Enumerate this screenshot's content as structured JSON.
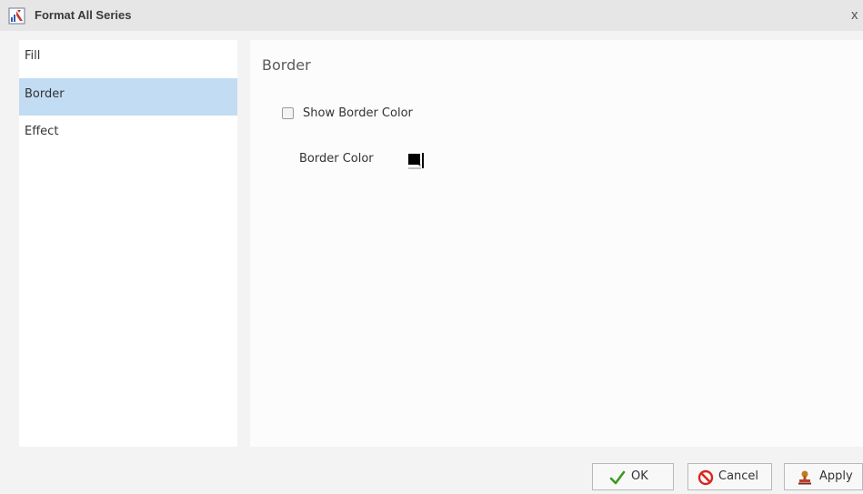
{
  "dialog": {
    "title": "Format All Series",
    "close_symbol": "x"
  },
  "nav": {
    "items": [
      {
        "label": "Fill",
        "selected": false
      },
      {
        "label": "Border",
        "selected": true
      },
      {
        "label": "Effect",
        "selected": false
      }
    ]
  },
  "border": {
    "section_title": "Border",
    "show_border_color_label": "Show Border Color",
    "show_border_color_checked": false,
    "border_color_label": "Border Color",
    "border_color_value": "#000000"
  },
  "footer": {
    "ok_label": "OK",
    "cancel_label": "Cancel",
    "apply_label": "Apply"
  },
  "icons": {
    "title": "chart-format-icon",
    "ok": "checkmark-icon",
    "cancel": "cancel-icon",
    "apply": "apply-stamp-icon"
  },
  "colors": {
    "selected_item": "#c2dcf4",
    "title_bar": "#e6e6e6",
    "ok_check": "#3a9a1c",
    "cancel_red": "#d9261c"
  }
}
